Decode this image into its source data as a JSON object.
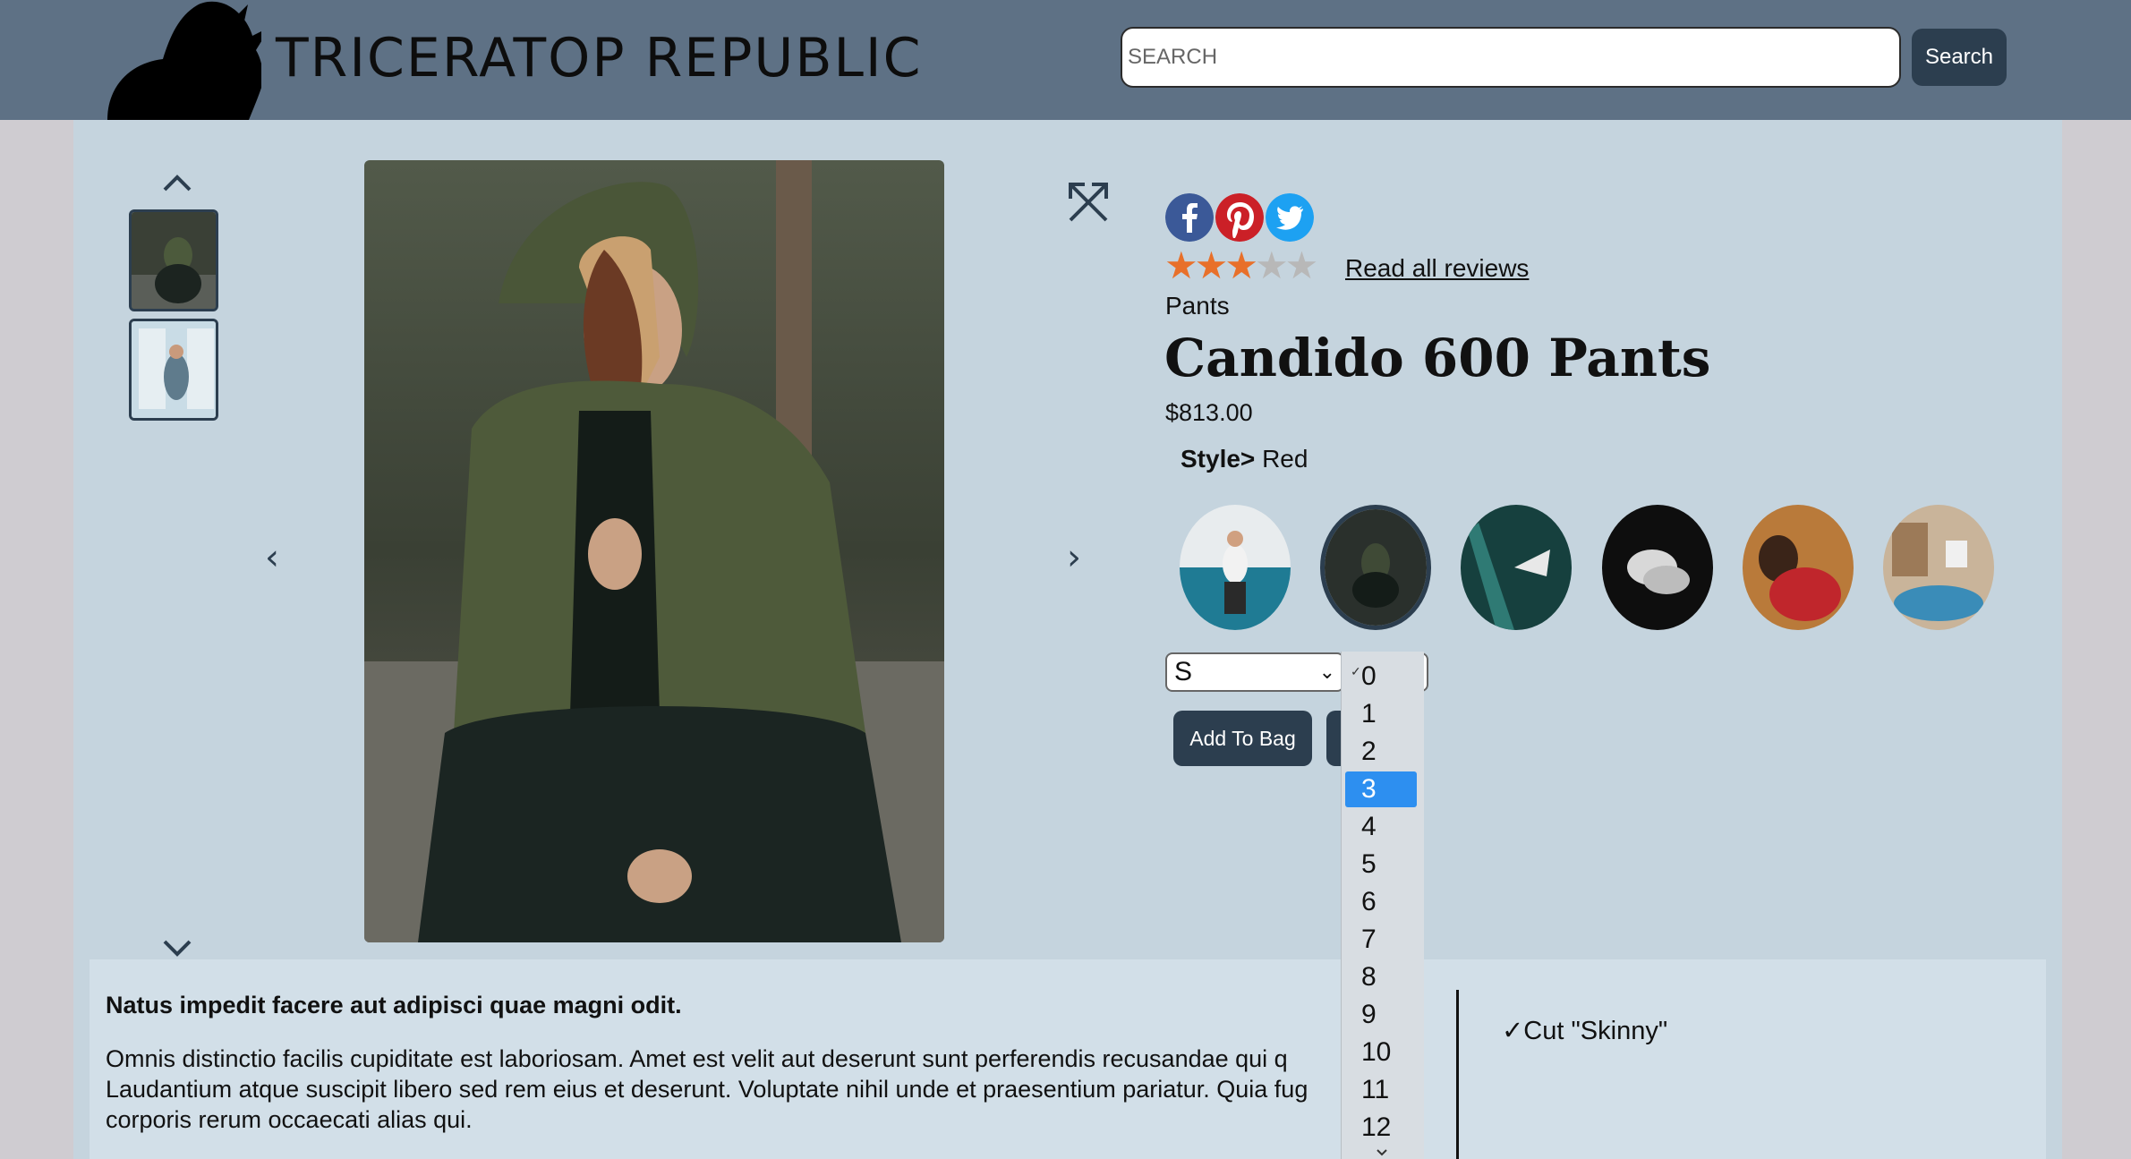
{
  "header": {
    "brand": "TRICERATOP REPUBLIC",
    "search_placeholder": "SEARCH",
    "search_button": "Search"
  },
  "gallery": {
    "prev_arrow": "‹",
    "next_arrow": "›"
  },
  "product": {
    "rating": 3,
    "rating_max": 5,
    "reviews_link": "Read all reviews",
    "category": "Pants",
    "title": "Candido 600 Pants",
    "price": "$813.00",
    "style_label": "Style>",
    "style_value": "Red",
    "size_selected": "S",
    "add_to_bag": "Add To Bag"
  },
  "quantity_dropdown": {
    "options": [
      "0",
      "1",
      "2",
      "3",
      "4",
      "5",
      "6",
      "7",
      "8",
      "9",
      "10",
      "11",
      "12"
    ],
    "selected": "3",
    "checked": "0",
    "check_mark": "✓"
  },
  "description": {
    "heading": "Natus impedit facere aut adipisci quae magni odit.",
    "body_line1": "Omnis distinctio facilis cupiditate est laboriosam. Amet est velit aut deserunt sunt perferendis recusandae qui q",
    "body_line2": "Laudantium atque suscipit libero sed rem eius et deserunt. Voluptate nihil unde et praesentium pariatur. Quia fug",
    "body_line3": "corporis rerum occaecati alias qui.",
    "feature": "✓Cut \"Skinny\""
  },
  "colors": {
    "header_bg": "#5e7185",
    "main_bg": "#c5d4de",
    "accent_dark": "#2c3e4f",
    "star_on": "#e8702a",
    "dropdown_highlight": "#2d8ff0"
  }
}
